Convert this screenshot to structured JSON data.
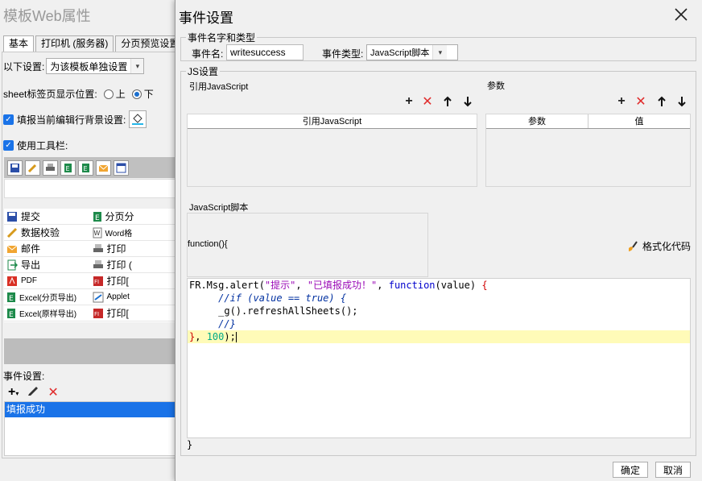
{
  "background_window": {
    "title": "模板Web属性",
    "tabs": [
      "基本",
      "打印机 (服务器)",
      "分页预览设置"
    ],
    "setting_label": "以下设置:",
    "setting_value": "为该模板单独设置",
    "sheet_tab_label": "sheet标签页显示位置:",
    "radio_top": "上",
    "radio_bottom": "下",
    "fill_bg_label": "填报当前编辑行背景设置:",
    "use_toolbar_label": "使用工具栏:",
    "toolbar_buttons": [
      [
        "提交",
        "分页分"
      ],
      [
        "数据校验",
        "Word格"
      ],
      [
        "邮件",
        "打印"
      ],
      [
        "导出",
        "打印 ("
      ],
      [
        "PDF",
        "打印["
      ],
      [
        "Excel(分页导出)",
        "Applet"
      ],
      [
        "Excel(原样导出)",
        "打印["
      ]
    ],
    "event_settings_label": "事件设置:",
    "event_item": "填报成功"
  },
  "dialog": {
    "title": "事件设置",
    "name_type_group": "事件名字和类型",
    "event_name_label": "事件名:",
    "event_name_value": "writesuccess",
    "event_type_label": "事件类型:",
    "event_type_value": "JavaScript脚本",
    "js_group": "JS设置",
    "ref_js_label": "引用JavaScript",
    "params_label": "参数",
    "ref_js_header": "引用JavaScript",
    "param_header": "参数",
    "value_header": "值",
    "script_label": "JavaScript脚本",
    "function_sig": "function(){",
    "format_code": "格式化代码",
    "closing_brace": "}",
    "ok": "确定",
    "cancel": "取消"
  },
  "code": {
    "line1": [
      "FR.Msg.alert(",
      "\"提示\"",
      ", ",
      "\"已填报成功！\"",
      ", ",
      "function",
      "(value) ",
      "{"
    ],
    "line2": "//if (value == true) {",
    "line3": "_g().refreshAllSheets();",
    "line4": "//}",
    "line5": [
      "}",
      ", ",
      "100",
      ");"
    ]
  }
}
